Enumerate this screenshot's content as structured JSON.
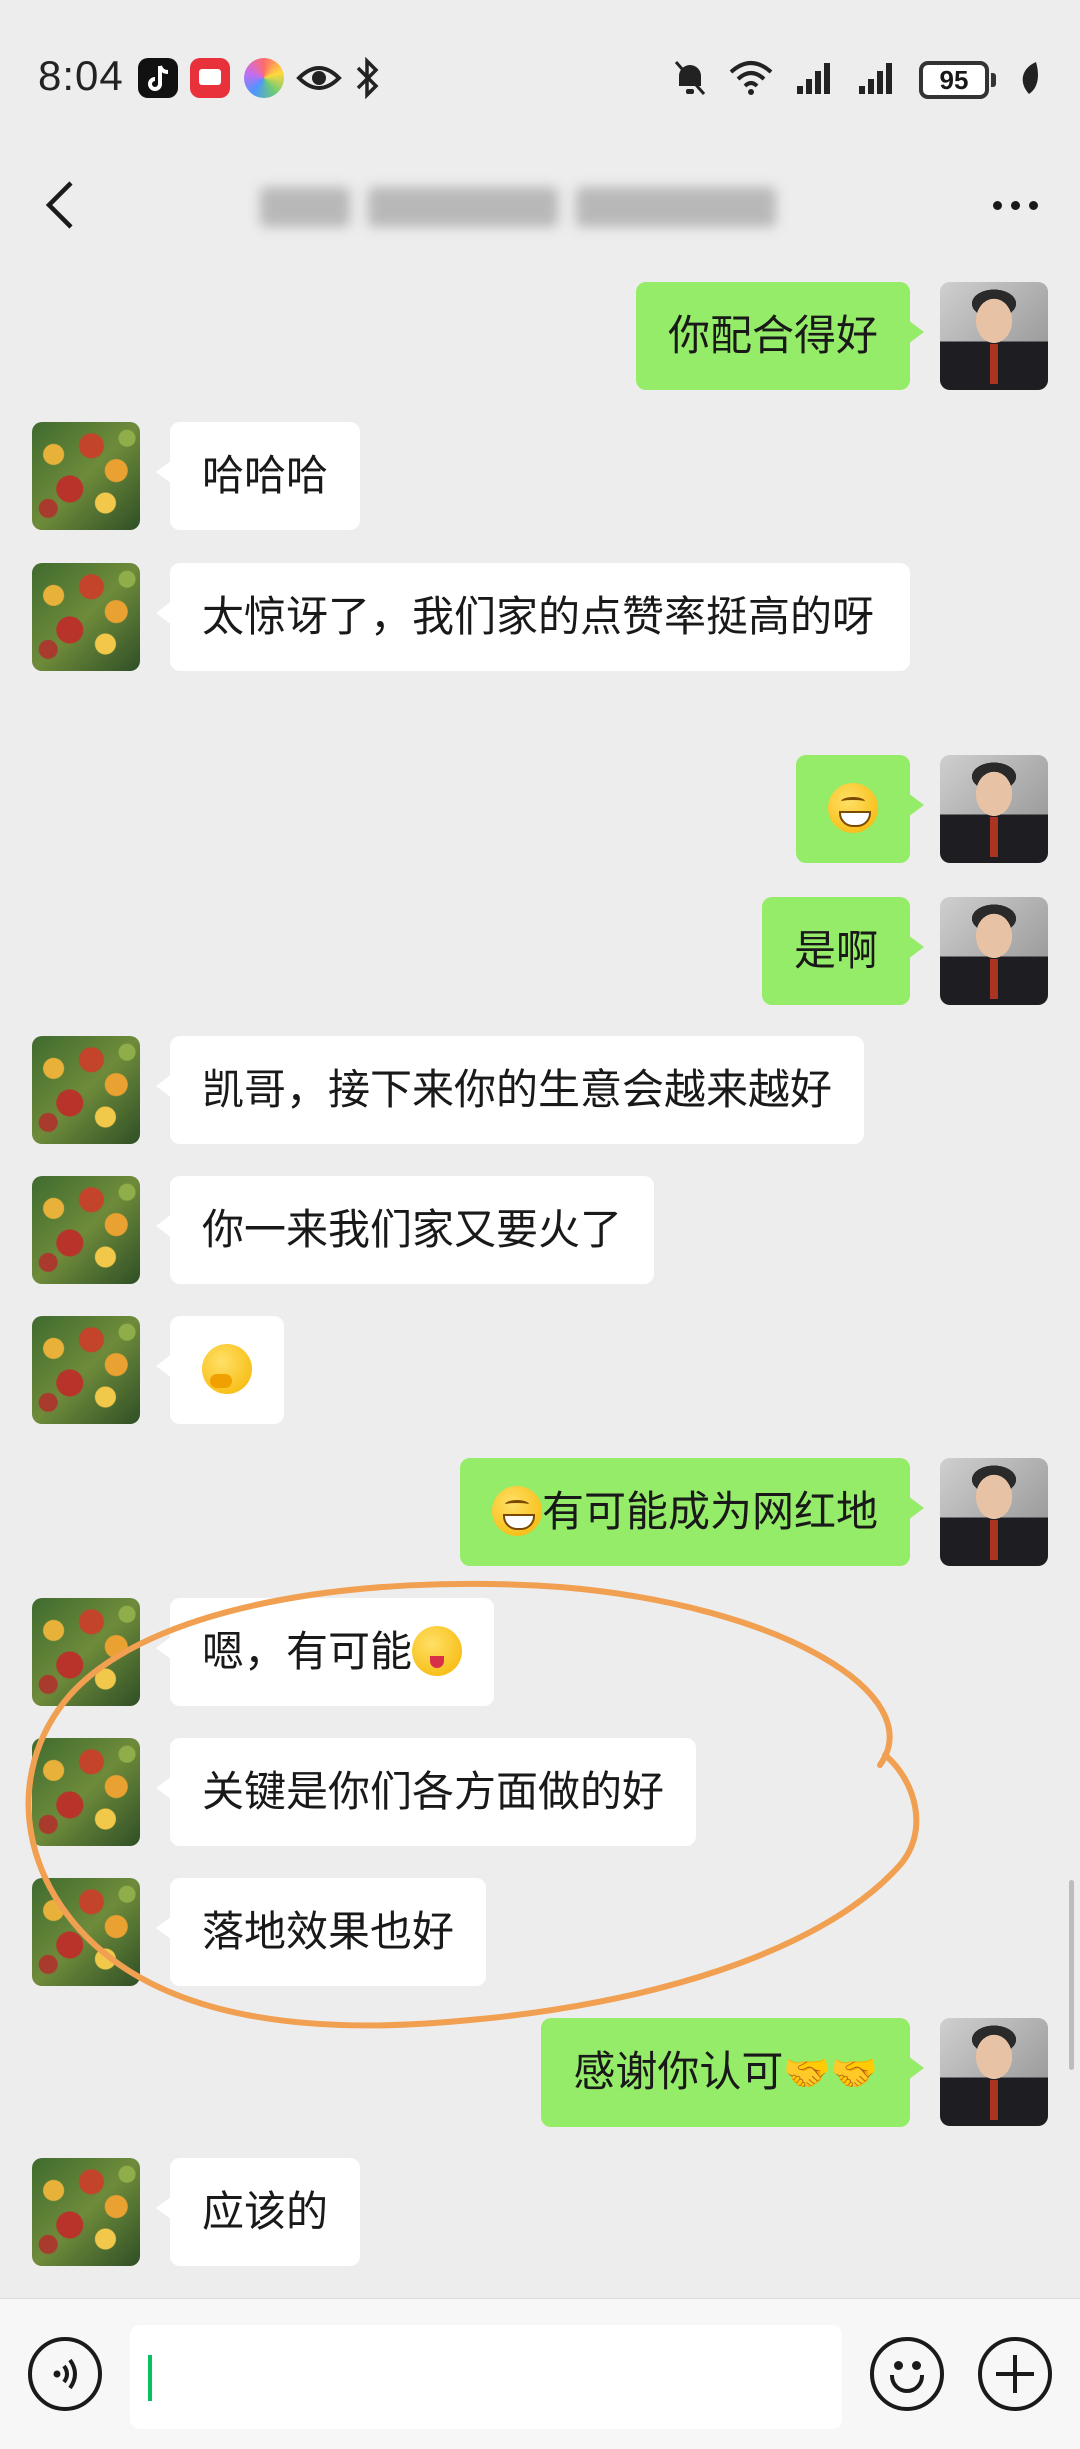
{
  "status_bar": {
    "time": "8:04",
    "battery_level": "95",
    "app_icons": [
      "tiktok-icon",
      "red-app-icon",
      "gallery-icon",
      "eye-icon",
      "bluetooth-icon"
    ],
    "right_icons": [
      "mute-bell-icon",
      "wifi-icon",
      "signal-icon",
      "signal-icon",
      "battery-icon",
      "leaf-icon"
    ]
  },
  "navbar": {
    "title_blurred": true
  },
  "messages": [
    {
      "side": "out",
      "text": "你配合得好"
    },
    {
      "side": "in",
      "text": "哈哈哈"
    },
    {
      "side": "in",
      "text": "太惊讶了，我们家的点赞率挺高的呀"
    },
    {
      "side": "out",
      "text": "",
      "emoji": "grin-emoji"
    },
    {
      "side": "out",
      "text": "是啊"
    },
    {
      "side": "in",
      "text": "凯哥，接下来你的生意会越来越好"
    },
    {
      "side": "in",
      "text": "你一来我们家又要火了"
    },
    {
      "side": "in",
      "text": "",
      "emoji": "thinking-emoji"
    },
    {
      "side": "out",
      "text": "有可能成为网红地",
      "emoji": "grin-emoji"
    },
    {
      "side": "in",
      "text": "嗯，有可能",
      "emoji": "wink-emoji"
    },
    {
      "side": "in",
      "text": "关键是你们各方面做的好"
    },
    {
      "side": "in",
      "text": "落地效果也好"
    },
    {
      "side": "out",
      "text": "感谢你认可",
      "emoji": "handshake-emoji"
    },
    {
      "side": "in",
      "text": "应该的"
    }
  ],
  "annotation": {
    "color": "#f0a050"
  },
  "input": {
    "value": ""
  },
  "colors": {
    "out_bubble": "#95ec69",
    "in_bubble": "#ffffff",
    "background": "#ededed",
    "caret": "#07c160"
  }
}
